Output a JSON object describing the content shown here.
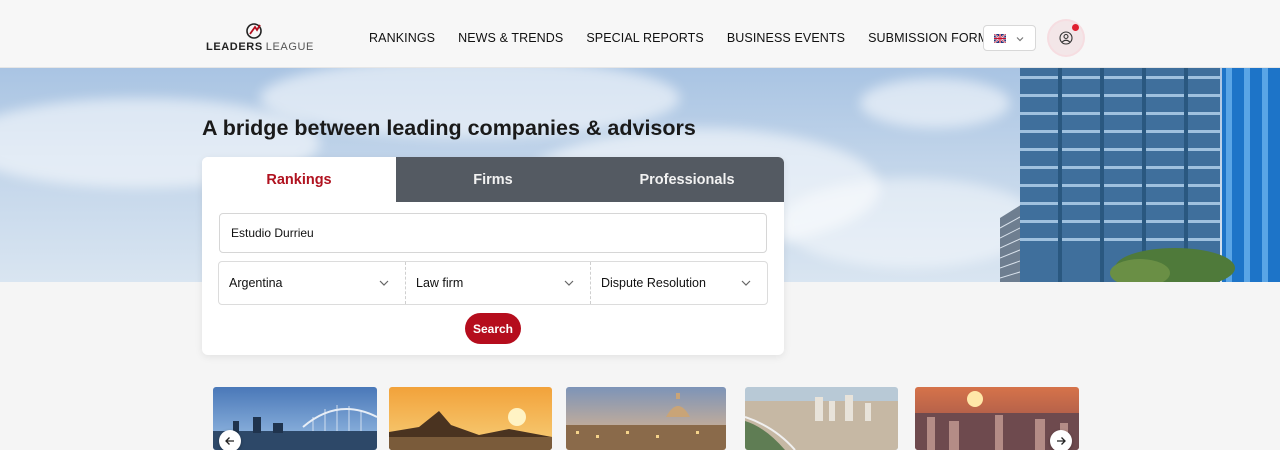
{
  "brand": {
    "name_bold": "LEADERS",
    "name_light": "LEAGUE",
    "accent": "#b50d1d"
  },
  "nav": {
    "items": [
      "RANKINGS",
      "NEWS & TRENDS",
      "SPECIAL REPORTS",
      "BUSINESS EVENTS",
      "SUBMISSION FORMS"
    ]
  },
  "header": {
    "language_icon": "uk-flag-icon",
    "user_icon": "user-icon",
    "has_notification": true
  },
  "hero": {
    "title": "A bridge between leading companies & advisors"
  },
  "search": {
    "tabs": [
      "Rankings",
      "Firms",
      "Professionals"
    ],
    "active_tab": "Rankings",
    "query_value": "Estudio Durrieu",
    "country": "Argentina",
    "category": "Law firm",
    "practice_area": "Dispute Resolution",
    "button_label": "Search"
  },
  "carousel": {
    "prev_icon": "arrow-left-icon",
    "next_icon": "arrow-right-icon",
    "image_count": 5
  }
}
